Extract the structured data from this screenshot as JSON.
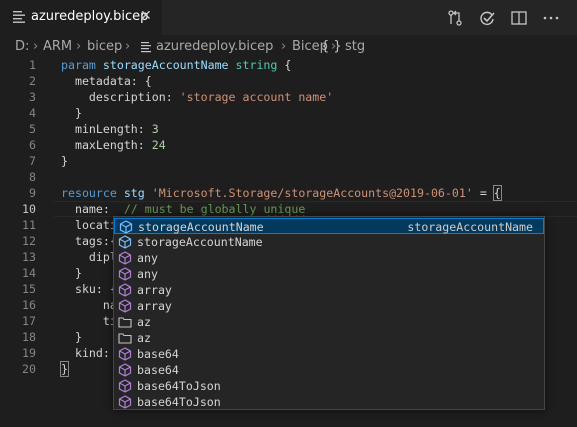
{
  "tab": {
    "title": "azuredeploy.bicep",
    "close_glyph": "✕"
  },
  "breadcrumb": {
    "items": [
      "D:",
      "ARM",
      "bicep",
      "azuredeploy.bicep",
      "Bicep",
      "stg"
    ],
    "symbol_glyph": "{ }"
  },
  "editor": {
    "current_line": 10,
    "lines": [
      {
        "n": "1",
        "segs": [
          {
            "t": "param ",
            "c": "kw"
          },
          {
            "t": "storageAccountName ",
            "c": "var"
          },
          {
            "t": "string ",
            "c": "typ"
          },
          {
            "t": "{",
            "c": "txt"
          }
        ]
      },
      {
        "n": "2",
        "segs": [
          {
            "t": "  metadata: {",
            "c": "txt"
          }
        ]
      },
      {
        "n": "3",
        "segs": [
          {
            "t": "    description: ",
            "c": "txt"
          },
          {
            "t": "'storage account name'",
            "c": "str"
          }
        ]
      },
      {
        "n": "4",
        "segs": [
          {
            "t": "  }",
            "c": "txt"
          }
        ]
      },
      {
        "n": "5",
        "segs": [
          {
            "t": "  minLength: ",
            "c": "txt"
          },
          {
            "t": "3",
            "c": "num"
          }
        ]
      },
      {
        "n": "6",
        "segs": [
          {
            "t": "  maxLength: ",
            "c": "txt"
          },
          {
            "t": "24",
            "c": "num"
          }
        ]
      },
      {
        "n": "7",
        "segs": [
          {
            "t": "}",
            "c": "txt"
          }
        ]
      },
      {
        "n": "8",
        "segs": []
      },
      {
        "n": "9",
        "segs": [
          {
            "t": "resource ",
            "c": "kw"
          },
          {
            "t": "stg ",
            "c": "var"
          },
          {
            "t": "'Microsoft.Storage/storageAccounts@2019-06-01'",
            "c": "str"
          },
          {
            "t": " = ",
            "c": "txt"
          },
          {
            "t": "{",
            "c": "txt bracket"
          }
        ]
      },
      {
        "n": "10",
        "segs": [
          {
            "t": "  name:  ",
            "c": "txt"
          },
          {
            "t": "// must be globally ",
            "c": "cmt"
          },
          {
            "t": "unique",
            "c": "cmt squig"
          }
        ]
      },
      {
        "n": "11",
        "segs": [
          {
            "t": "  locati",
            "c": "txt"
          }
        ]
      },
      {
        "n": "12",
        "segs": [
          {
            "t": "  tags:{",
            "c": "txt"
          }
        ]
      },
      {
        "n": "13",
        "segs": [
          {
            "t": "    dipl",
            "c": "txt"
          }
        ]
      },
      {
        "n": "14",
        "segs": [
          {
            "t": "  }",
            "c": "txt"
          }
        ]
      },
      {
        "n": "15",
        "segs": [
          {
            "t": "  sku: {",
            "c": "txt"
          }
        ]
      },
      {
        "n": "16",
        "segs": [
          {
            "t": "      na",
            "c": "txt"
          }
        ]
      },
      {
        "n": "17",
        "segs": [
          {
            "t": "      ti",
            "c": "txt"
          }
        ]
      },
      {
        "n": "18",
        "segs": [
          {
            "t": "  }",
            "c": "txt"
          }
        ]
      },
      {
        "n": "19",
        "segs": [
          {
            "t": "  kind: ",
            "c": "txt"
          }
        ]
      },
      {
        "n": "20",
        "segs": [
          {
            "t": "}",
            "c": "txt bracket"
          }
        ]
      }
    ]
  },
  "suggestions": [
    {
      "label": "storageAccountName",
      "icon": "variable-icon",
      "detail": "storageAccountName",
      "selected": true
    },
    {
      "label": "storageAccountName",
      "icon": "variable-icon",
      "detail": ""
    },
    {
      "label": "any",
      "icon": "function-icon",
      "detail": ""
    },
    {
      "label": "any",
      "icon": "function-icon",
      "detail": ""
    },
    {
      "label": "array",
      "icon": "function-icon",
      "detail": ""
    },
    {
      "label": "array",
      "icon": "function-icon",
      "detail": ""
    },
    {
      "label": "az",
      "icon": "namespace-folder-icon",
      "detail": ""
    },
    {
      "label": "az",
      "icon": "namespace-folder-icon",
      "detail": ""
    },
    {
      "label": "base64",
      "icon": "function-icon",
      "detail": ""
    },
    {
      "label": "base64",
      "icon": "function-icon",
      "detail": ""
    },
    {
      "label": "base64ToJson",
      "icon": "function-icon",
      "detail": ""
    },
    {
      "label": "base64ToJson",
      "icon": "function-icon",
      "detail": ""
    }
  ],
  "colors": {
    "accent": "#007fd4",
    "selection": "#04395e",
    "background": "#1e1e1e"
  }
}
